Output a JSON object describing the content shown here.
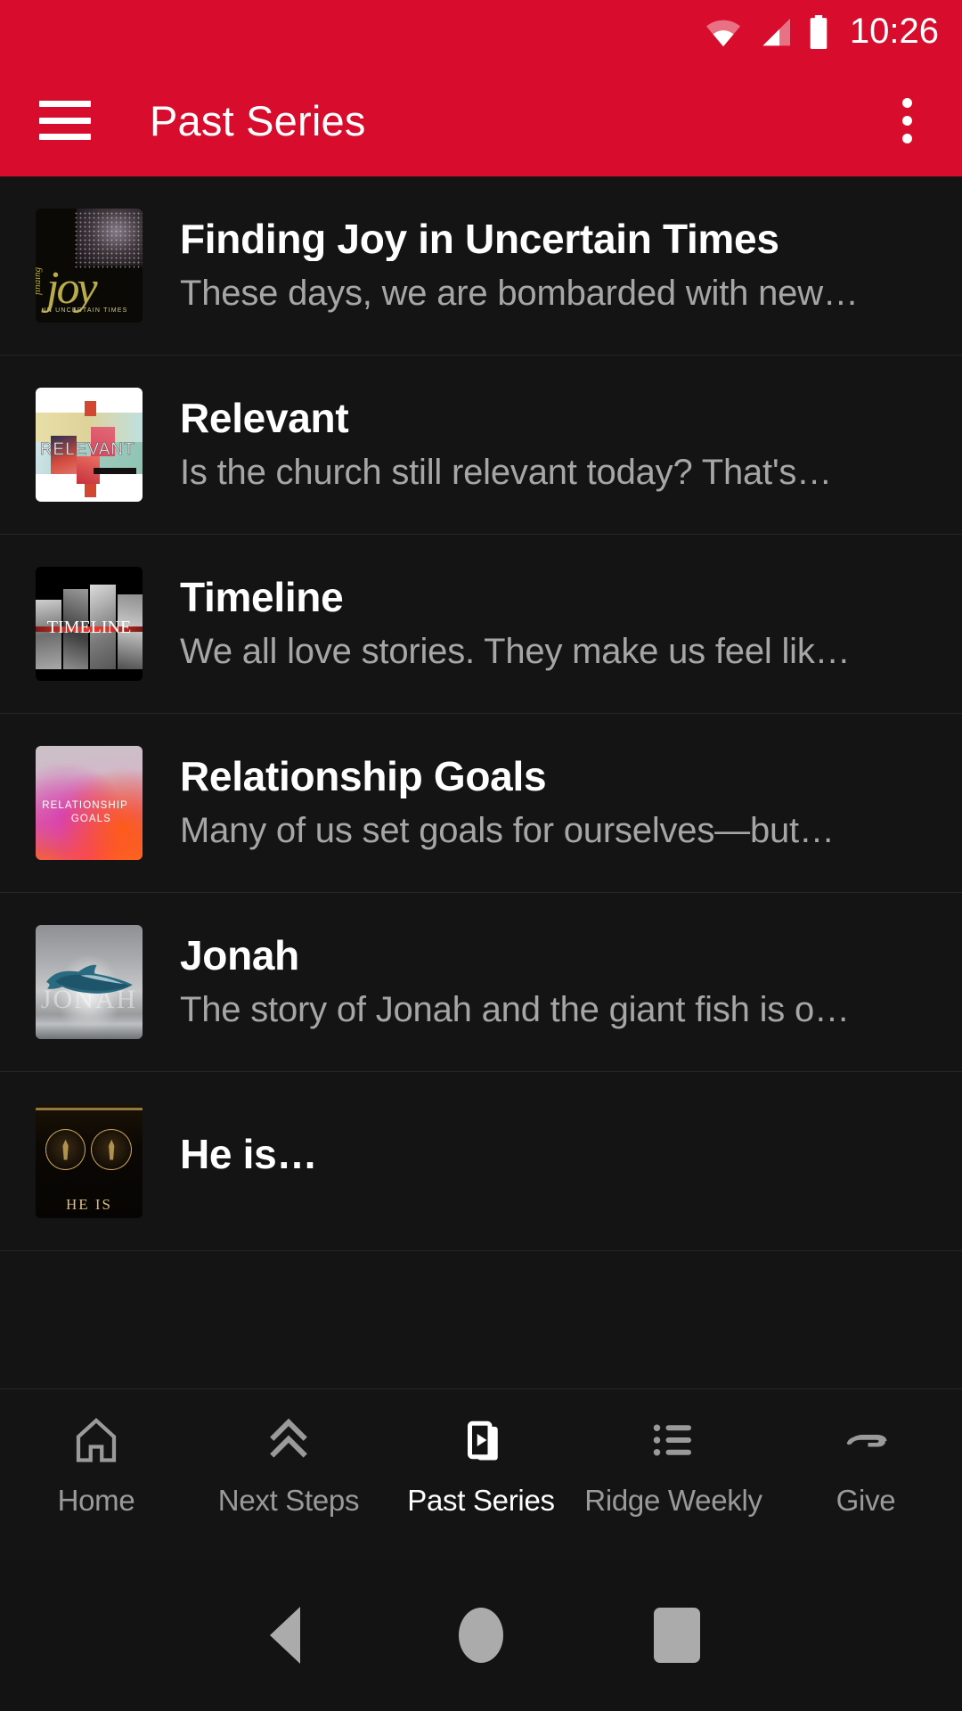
{
  "status_bar": {
    "time": "10:26",
    "icons": [
      "wifi-icon",
      "cellular-signal-icon",
      "battery-icon"
    ]
  },
  "app_bar": {
    "menu_icon": "hamburger-menu-icon",
    "title": "Past Series",
    "overflow_icon": "overflow-menu-icon",
    "background_color": "#D80C2C"
  },
  "series_list": [
    {
      "title": "Finding Joy in Uncertain Times",
      "subtitle": "These days, we are bombarded with new…",
      "thumbnail": "finding-joy-artwork",
      "art_text": {
        "small": "finding",
        "main": "joy",
        "tag": "IN UNCERTAIN TIMES"
      }
    },
    {
      "title": "Relevant",
      "subtitle": "Is the church still relevant today? That's…",
      "thumbnail": "relevant-artwork",
      "art_text": {
        "main": "RELEVANT"
      }
    },
    {
      "title": "Timeline",
      "subtitle": "We all love stories. They make us feel lik…",
      "thumbnail": "timeline-artwork",
      "art_text": {
        "main": "TIMELINE"
      }
    },
    {
      "title": "Relationship Goals",
      "subtitle": "Many of us set goals for ourselves—but…",
      "thumbnail": "relationship-goals-artwork",
      "art_text": {
        "line1": "RELATIONSHIP",
        "line2": "GOALS"
      }
    },
    {
      "title": "Jonah",
      "subtitle": "The story of Jonah and the giant fish is o…",
      "thumbnail": "jonah-artwork",
      "art_text": {
        "main": "JONAH"
      }
    },
    {
      "title": "He is…",
      "subtitle": "",
      "thumbnail": "he-is-artwork",
      "art_text": {
        "main": "HE IS"
      }
    }
  ],
  "bottom_nav": {
    "active_index": 2,
    "items": [
      {
        "label": "Home",
        "icon": "home-icon"
      },
      {
        "label": "Next Steps",
        "icon": "double-chevron-up-icon"
      },
      {
        "label": "Past Series",
        "icon": "video-card-stack-icon"
      },
      {
        "label": "Ridge Weekly",
        "icon": "list-icon"
      },
      {
        "label": "Give",
        "icon": "giving-hand-icon"
      }
    ]
  },
  "system_nav": {
    "back": "back-triangle-icon",
    "home": "home-circle-icon",
    "recents": "recents-square-icon"
  },
  "colors": {
    "brand_red": "#D80C2C",
    "list_background": "#141414",
    "title_text": "#FFFFFF",
    "subtitle_text": "#A6A6A6",
    "nav_inactive": "#9A9A9A"
  }
}
